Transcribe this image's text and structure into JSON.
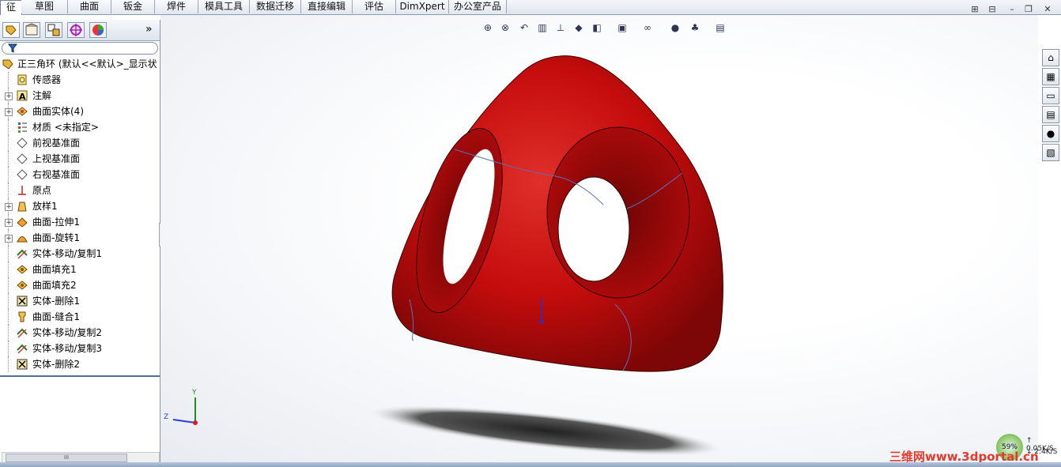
{
  "tabs": [
    {
      "label": "征",
      "active": true
    },
    {
      "label": "草图"
    },
    {
      "label": "曲面"
    },
    {
      "label": "钣金"
    },
    {
      "label": "焊件"
    },
    {
      "label": "模具工具"
    },
    {
      "label": "数据迁移"
    },
    {
      "label": "直接编辑"
    },
    {
      "label": "评估"
    },
    {
      "label": "DimXpert"
    },
    {
      "label": "办公室产品"
    }
  ],
  "panel_tabs": [
    "feature-manager",
    "property-manager",
    "configuration-manager",
    "dimxpert-manager",
    "display-manager"
  ],
  "panel_expand_glyph": "»",
  "tree": {
    "root": "正三角环 (默认<<默认>_显示状",
    "items": [
      {
        "label": "传感器",
        "icon": "sensor-icon",
        "expandable": false
      },
      {
        "label": "注解",
        "icon": "annotation-icon",
        "expandable": true
      },
      {
        "label": "曲面实体(4)",
        "icon": "surface-bodies-icon",
        "expandable": true
      },
      {
        "label": "材质 <未指定>",
        "icon": "material-icon",
        "expandable": false
      },
      {
        "label": "前视基准面",
        "icon": "plane-icon",
        "expandable": false
      },
      {
        "label": "上视基准面",
        "icon": "plane-icon",
        "expandable": false
      },
      {
        "label": "右视基准面",
        "icon": "plane-icon",
        "expandable": false
      },
      {
        "label": "原点",
        "icon": "origin-icon",
        "expandable": false
      },
      {
        "label": "放样1",
        "icon": "loft-icon",
        "expandable": true
      },
      {
        "label": "曲面-拉伸1",
        "icon": "surface-extrude-icon",
        "expandable": true
      },
      {
        "label": "曲面-旋转1",
        "icon": "surface-revolve-icon",
        "expandable": true
      },
      {
        "label": "实体-移动/复制1",
        "icon": "move-copy-icon",
        "expandable": false
      },
      {
        "label": "曲面填充1",
        "icon": "surface-fill-icon",
        "expandable": false
      },
      {
        "label": "曲面填充2",
        "icon": "surface-fill-icon",
        "expandable": false
      },
      {
        "label": "实体-删除1",
        "icon": "delete-body-icon",
        "expandable": false
      },
      {
        "label": "曲面-缝合1",
        "icon": "knit-icon",
        "expandable": false
      },
      {
        "label": "实体-移动/复制2",
        "icon": "move-copy-icon",
        "expandable": false
      },
      {
        "label": "实体-移动/复制3",
        "icon": "move-copy-icon",
        "expandable": false
      },
      {
        "label": "实体-删除2",
        "icon": "delete-body-icon",
        "expandable": false
      }
    ]
  },
  "scrollbar_grip": "III",
  "triad": {
    "y": "Y",
    "z": "Z"
  },
  "right_tools": [
    "home-icon",
    "design-library-icon",
    "file-explorer-icon",
    "view-palette-icon",
    "appearances-icon",
    "custom-properties-icon"
  ],
  "status": {
    "cpu_percent": "59%",
    "net_up": "↑ 0.05K/S",
    "net_down": "↓ 2.4K/S"
  },
  "watermark": "三维网www.3dportal.cn",
  "colors": {
    "model": "#c40c0c",
    "accent": "#4f6fa1"
  }
}
